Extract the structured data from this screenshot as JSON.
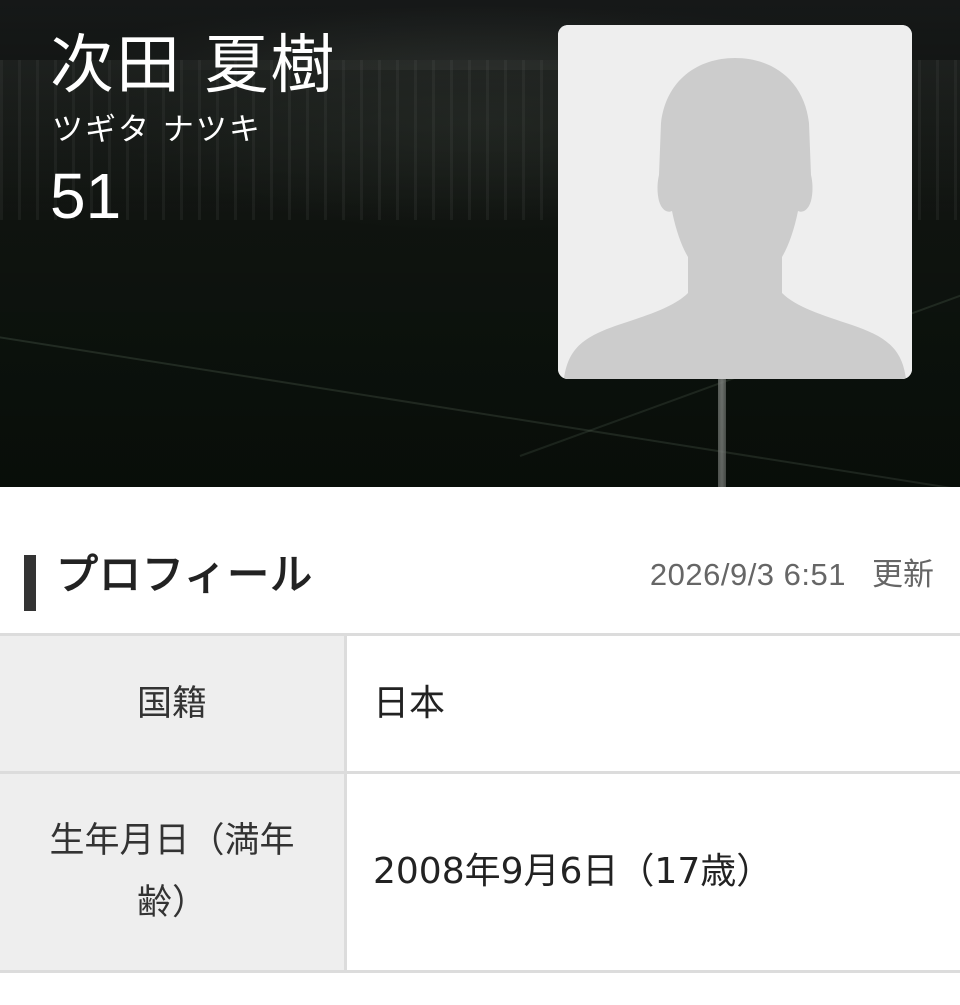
{
  "player": {
    "name": "次田 夏樹",
    "kana": "ツギタ ナツキ",
    "number": "51",
    "photo_icon": "silhouette-placeholder-icon"
  },
  "profile": {
    "title": "プロフィール",
    "updated_at": "2026/9/3 6:51",
    "updated_label": "更新",
    "rows": [
      {
        "label": "国籍",
        "value": "日本"
      },
      {
        "label": "生年月日（満年齢）",
        "value": "2008年9月6日（17歳）"
      }
    ]
  },
  "colors": {
    "header_overlay": "#101410",
    "text_light": "#ffffff",
    "section_bar": "#333333",
    "table_header_bg": "#eeeeee",
    "table_border": "#dcdcdc",
    "muted_text": "#666666"
  }
}
